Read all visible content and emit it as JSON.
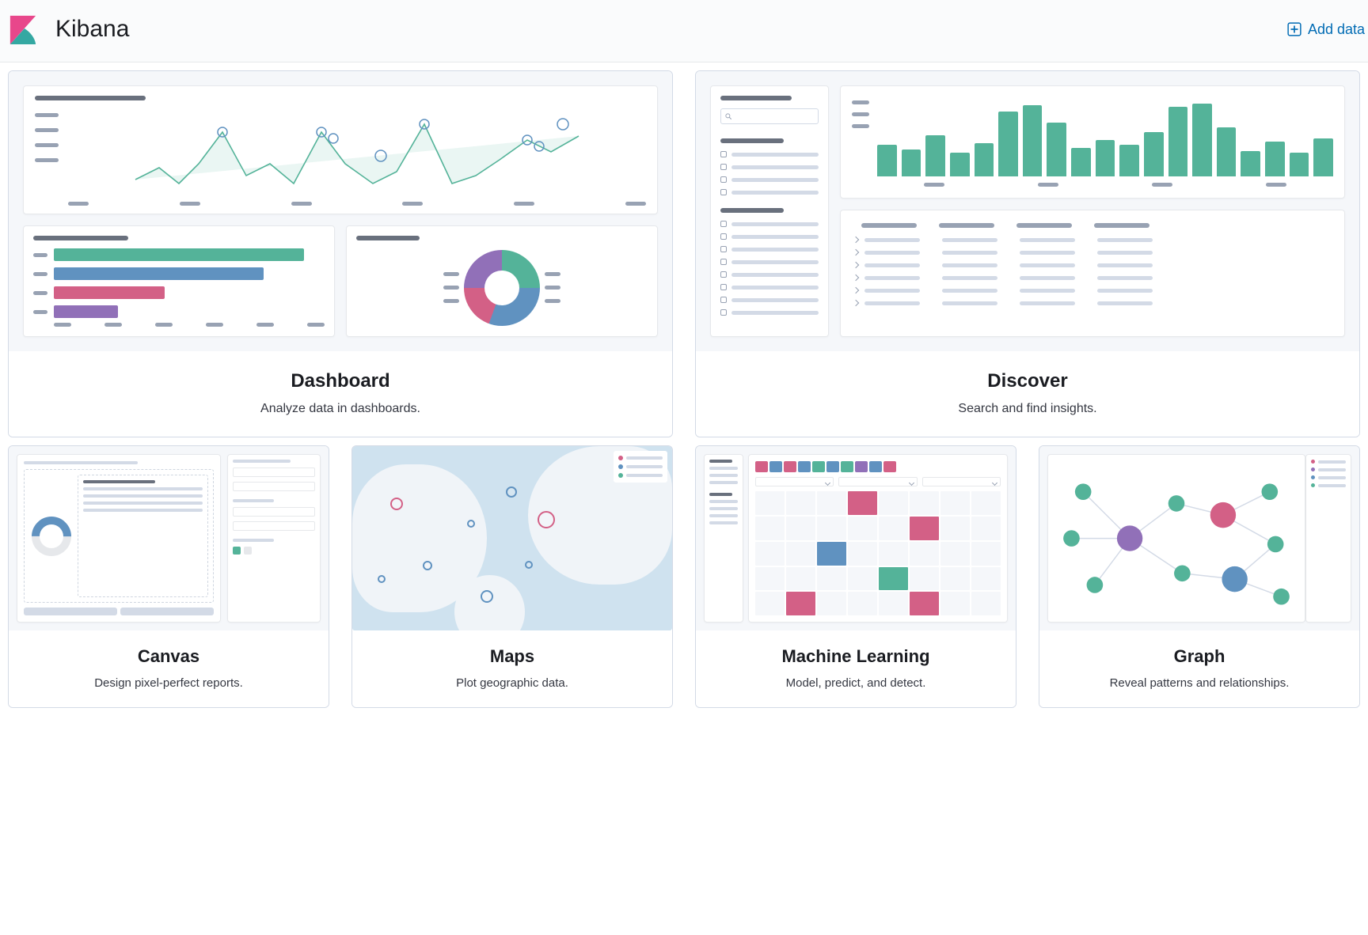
{
  "header": {
    "app_title": "Kibana",
    "add_data_label": "Add data"
  },
  "cards": {
    "dashboard": {
      "title": "Dashboard",
      "description": "Analyze data in dashboards."
    },
    "discover": {
      "title": "Discover",
      "description": "Search and find insights."
    },
    "canvas": {
      "title": "Canvas",
      "description": "Design pixel-perfect reports."
    },
    "maps": {
      "title": "Maps",
      "description": "Plot geographic data."
    },
    "ml": {
      "title": "Machine Learning",
      "description": "Model, predict, and detect."
    },
    "graph": {
      "title": "Graph",
      "description": "Reveal patterns and relationships."
    }
  },
  "colors": {
    "green": "#54b399",
    "blue": "#6092c0",
    "pink": "#d36086",
    "purple": "#9170b8",
    "gray": "#98a2b3",
    "lightgray": "#d3dae6"
  }
}
